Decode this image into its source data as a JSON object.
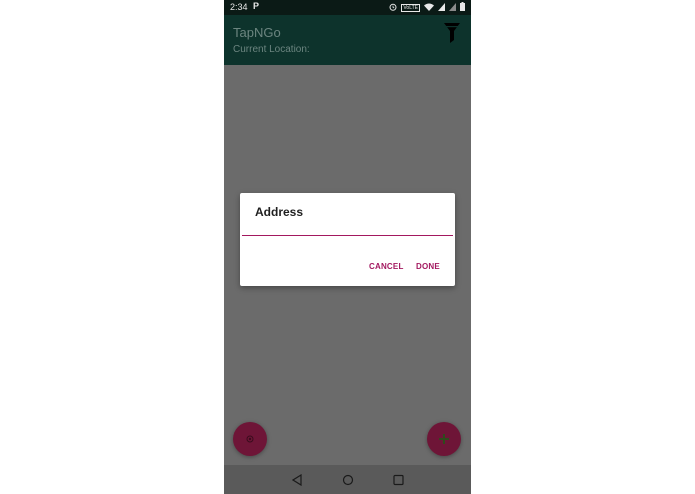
{
  "status_bar": {
    "time": "2:34",
    "p_badge": "P",
    "volte": "VoLTE",
    "icons": [
      "alarm-icon",
      "wifi-icon",
      "signal-icon",
      "signal-icon",
      "battery-icon"
    ]
  },
  "app_bar": {
    "title": "TapNGo",
    "location_label": "Current Location:",
    "action_icon": "filter-funnel-icon"
  },
  "dialog": {
    "title": "Address",
    "input_value": "",
    "cancel_label": "CANCEL",
    "done_label": "DONE",
    "accent_color": "#a3185f"
  },
  "fabs": {
    "left_icon": "location-target-icon",
    "right_icon": "add-icon",
    "color": "#6e1537"
  },
  "nav_bar": {
    "icons": [
      "back-icon",
      "home-icon",
      "recents-icon"
    ]
  }
}
